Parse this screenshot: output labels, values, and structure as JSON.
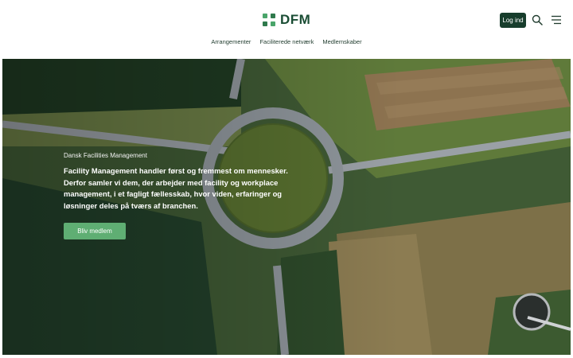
{
  "header": {
    "logo_text": "DFM",
    "login_label": "Log ind"
  },
  "icons": {
    "logo": "dfm-logo-icon",
    "search": "search-icon",
    "menu": "hamburger-menu-icon"
  },
  "nav": {
    "items": [
      {
        "label": "Arrangementer"
      },
      {
        "label": "Faciliterede netværk"
      },
      {
        "label": "Medlemskaber"
      }
    ]
  },
  "hero": {
    "eyebrow": "Dansk Facilities Management",
    "headline": "Facility Management handler først og fremmest om mennesker. Derfor samler vi dem, der arbejder med facility og workplace management, i et fagligt fællesskab, hvor viden, erfaringer og løsninger deles på tværs af branchen.",
    "cta_label": "Bliv medlem"
  },
  "colors": {
    "brand_dark": "#173d2c",
    "brand_green": "#4aa56a",
    "cta_green": "#5fae73"
  }
}
